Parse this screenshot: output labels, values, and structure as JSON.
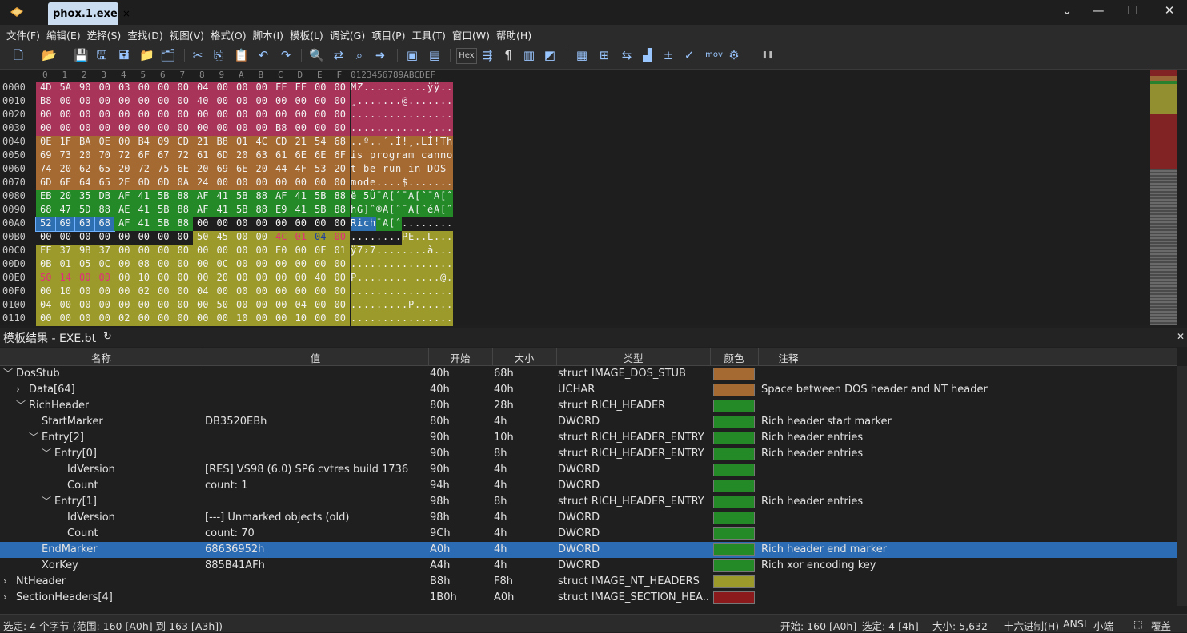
{
  "titlebar": {
    "tab_label": "phox.1.exe",
    "tab_close": "×",
    "btn_dropdown": "⌄",
    "btn_minimize": "—",
    "btn_maximize": "☐",
    "btn_close": "✕"
  },
  "menu": [
    "文件(F)",
    "编辑(E)",
    "选择(S)",
    "查找(D)",
    "视图(V)",
    "格式(O)",
    "脚本(I)",
    "模板(L)",
    "调试(G)",
    "项目(P)",
    "工具(T)",
    "窗口(W)",
    "帮助(H)"
  ],
  "toolbar_icons": [
    "new-file-icon",
    "open-icon",
    "save-icon",
    "save-as-icon",
    "save-all-icon",
    "open-folder-icon",
    "open-project-icon",
    "cut-icon",
    "copy-icon",
    "paste-icon",
    "undo-icon",
    "redo-icon",
    "find-icon",
    "replace-icon",
    "find-in-files-icon",
    "goto-icon",
    "run-script-icon",
    "run-template-icon",
    "hex-mode-icon",
    "columns-icon",
    "paragraph-icon",
    "bookmarks-icon",
    "highlight-icon",
    "calculator-icon",
    "checksum-icon",
    "compare-icon",
    "histogram-icon",
    "base-converter-icon",
    "inspector-icon",
    "disassembler-icon",
    "process-icon",
    "pause-icon"
  ],
  "toolbar_text": {
    "hex": "Hex",
    "mov": "mov",
    "pilcrow": "¶"
  },
  "hex": {
    "col_headers": [
      "0",
      "1",
      "2",
      "3",
      "4",
      "5",
      "6",
      "7",
      "8",
      "9",
      "A",
      "B",
      "C",
      "D",
      "E",
      "F"
    ],
    "ascii_header": "0123456789ABCDEF",
    "rows": [
      {
        "off": "0000",
        "bytes": [
          "4D",
          "5A",
          "90",
          "00",
          "03",
          "00",
          "00",
          "00",
          "04",
          "00",
          "00",
          "00",
          "FF",
          "FF",
          "00",
          "00"
        ],
        "ascii": "MZ..........ÿÿ.."
      },
      {
        "off": "0010",
        "bytes": [
          "B8",
          "00",
          "00",
          "00",
          "00",
          "00",
          "00",
          "00",
          "40",
          "00",
          "00",
          "00",
          "00",
          "00",
          "00",
          "00"
        ],
        "ascii": "¸.......@......."
      },
      {
        "off": "0020",
        "bytes": [
          "00",
          "00",
          "00",
          "00",
          "00",
          "00",
          "00",
          "00",
          "00",
          "00",
          "00",
          "00",
          "00",
          "00",
          "00",
          "00"
        ],
        "ascii": "................"
      },
      {
        "off": "0030",
        "bytes": [
          "00",
          "00",
          "00",
          "00",
          "00",
          "00",
          "00",
          "00",
          "00",
          "00",
          "00",
          "00",
          "B8",
          "00",
          "00",
          "00"
        ],
        "ascii": "............¸..."
      },
      {
        "off": "0040",
        "bytes": [
          "0E",
          "1F",
          "BA",
          "0E",
          "00",
          "B4",
          "09",
          "CD",
          "21",
          "B8",
          "01",
          "4C",
          "CD",
          "21",
          "54",
          "68"
        ],
        "ascii": "..º..´.Í!¸.LÍ!Th"
      },
      {
        "off": "0050",
        "bytes": [
          "69",
          "73",
          "20",
          "70",
          "72",
          "6F",
          "67",
          "72",
          "61",
          "6D",
          "20",
          "63",
          "61",
          "6E",
          "6E",
          "6F"
        ],
        "ascii": "is program canno"
      },
      {
        "off": "0060",
        "bytes": [
          "74",
          "20",
          "62",
          "65",
          "20",
          "72",
          "75",
          "6E",
          "20",
          "69",
          "6E",
          "20",
          "44",
          "4F",
          "53",
          "20"
        ],
        "ascii": "t be run in DOS "
      },
      {
        "off": "0070",
        "bytes": [
          "6D",
          "6F",
          "64",
          "65",
          "2E",
          "0D",
          "0D",
          "0A",
          "24",
          "00",
          "00",
          "00",
          "00",
          "00",
          "00",
          "00"
        ],
        "ascii": "mode....$......."
      },
      {
        "off": "0080",
        "bytes": [
          "EB",
          "20",
          "35",
          "DB",
          "AF",
          "41",
          "5B",
          "88",
          "AF",
          "41",
          "5B",
          "88",
          "AF",
          "41",
          "5B",
          "88"
        ],
        "ascii": "ë 5Û¯A[ˆ¯A[ˆ¯A[ˆ"
      },
      {
        "off": "0090",
        "bytes": [
          "68",
          "47",
          "5D",
          "88",
          "AE",
          "41",
          "5B",
          "88",
          "AF",
          "41",
          "5B",
          "88",
          "E9",
          "41",
          "5B",
          "88"
        ],
        "ascii": "hG]ˆ®A[ˆ¯A[ˆéA[ˆ"
      },
      {
        "off": "00A0",
        "bytes": [
          "52",
          "69",
          "63",
          "68",
          "AF",
          "41",
          "5B",
          "88",
          "00",
          "00",
          "00",
          "00",
          "00",
          "00",
          "00",
          "00"
        ],
        "ascii": "Rich¯A[ˆ........"
      },
      {
        "off": "00B0",
        "bytes": [
          "00",
          "00",
          "00",
          "00",
          "00",
          "00",
          "00",
          "00",
          "50",
          "45",
          "00",
          "00",
          "4C",
          "01",
          "04",
          "00"
        ],
        "ascii": "........PE..L..."
      },
      {
        "off": "00C0",
        "bytes": [
          "FF",
          "37",
          "9B",
          "37",
          "00",
          "00",
          "00",
          "00",
          "00",
          "00",
          "00",
          "00",
          "E0",
          "00",
          "0F",
          "01"
        ],
        "ascii": "ÿ7›7........à..."
      },
      {
        "off": "00D0",
        "bytes": [
          "0B",
          "01",
          "05",
          "0C",
          "00",
          "08",
          "00",
          "00",
          "00",
          "0C",
          "00",
          "00",
          "00",
          "00",
          "00",
          "00"
        ],
        "ascii": "................"
      },
      {
        "off": "00E0",
        "bytes": [
          "50",
          "14",
          "00",
          "00",
          "00",
          "10",
          "00",
          "00",
          "00",
          "20",
          "00",
          "00",
          "00",
          "00",
          "40",
          "00"
        ],
        "ascii": "P........ ....@."
      },
      {
        "off": "00F0",
        "bytes": [
          "00",
          "10",
          "00",
          "00",
          "00",
          "02",
          "00",
          "00",
          "04",
          "00",
          "00",
          "00",
          "00",
          "00",
          "00",
          "00"
        ],
        "ascii": "................"
      },
      {
        "off": "0100",
        "bytes": [
          "04",
          "00",
          "00",
          "00",
          "00",
          "00",
          "00",
          "00",
          "00",
          "50",
          "00",
          "00",
          "00",
          "04",
          "00",
          "00"
        ],
        "ascii": ".........P......"
      },
      {
        "off": "0110",
        "bytes": [
          "00",
          "00",
          "00",
          "00",
          "02",
          "00",
          "00",
          "00",
          "00",
          "00",
          "10",
          "00",
          "00",
          "10",
          "00",
          "00"
        ],
        "ascii": "................"
      }
    ]
  },
  "template_panel": {
    "title": "模板结果 - EXE.bt",
    "refresh_icon": "↻",
    "close_icon": "✕",
    "columns": [
      "名称",
      "值",
      "开始",
      "大小",
      "类型",
      "颜色",
      "注释"
    ],
    "rows": [
      {
        "toggle": "﹀",
        "indent": 0,
        "name": "DosStub",
        "value": "",
        "start": "40h",
        "size": "68h",
        "type": "struct IMAGE_DOS_STUB",
        "color": "#a46a32",
        "comment": "",
        "selected": false
      },
      {
        "toggle": "›",
        "indent": 1,
        "name": "Data[64]",
        "value": "",
        "start": "40h",
        "size": "40h",
        "type": "UCHAR",
        "color": "#a46a32",
        "comment": "Space between DOS header and NT header",
        "selected": false
      },
      {
        "toggle": "﹀",
        "indent": 1,
        "name": "RichHeader",
        "value": "",
        "start": "80h",
        "size": "28h",
        "type": "struct RICH_HEADER",
        "color": "#238a27",
        "comment": "",
        "selected": false
      },
      {
        "toggle": "",
        "indent": 2,
        "name": "StartMarker",
        "value": "DB3520EBh",
        "start": "80h",
        "size": "4h",
        "type": "DWORD",
        "color": "#238a27",
        "comment": "Rich header start marker",
        "selected": false
      },
      {
        "toggle": "﹀",
        "indent": 2,
        "name": "Entry[2]",
        "value": "",
        "start": "90h",
        "size": "10h",
        "type": "struct RICH_HEADER_ENTRY",
        "color": "#238a27",
        "comment": "Rich header entries",
        "selected": false
      },
      {
        "toggle": "﹀",
        "indent": 3,
        "name": "Entry[0]",
        "value": "",
        "start": "90h",
        "size": "8h",
        "type": "struct RICH_HEADER_ENTRY",
        "color": "#238a27",
        "comment": "Rich header entries",
        "selected": false
      },
      {
        "toggle": "",
        "indent": 4,
        "name": "IdVersion",
        "value": "[RES] VS98 (6.0) SP6 cvtres build 1736",
        "start": "90h",
        "size": "4h",
        "type": "DWORD",
        "color": "#238a27",
        "comment": "",
        "selected": false
      },
      {
        "toggle": "",
        "indent": 4,
        "name": "Count",
        "value": "count: 1",
        "start": "94h",
        "size": "4h",
        "type": "DWORD",
        "color": "#238a27",
        "comment": "",
        "selected": false
      },
      {
        "toggle": "﹀",
        "indent": 3,
        "name": "Entry[1]",
        "value": "",
        "start": "98h",
        "size": "8h",
        "type": "struct RICH_HEADER_ENTRY",
        "color": "#238a27",
        "comment": "Rich header entries",
        "selected": false
      },
      {
        "toggle": "",
        "indent": 4,
        "name": "IdVersion",
        "value": "[---] Unmarked objects (old)",
        "start": "98h",
        "size": "4h",
        "type": "DWORD",
        "color": "#238a27",
        "comment": "",
        "selected": false
      },
      {
        "toggle": "",
        "indent": 4,
        "name": "Count",
        "value": "count: 70",
        "start": "9Ch",
        "size": "4h",
        "type": "DWORD",
        "color": "#238a27",
        "comment": "",
        "selected": false
      },
      {
        "toggle": "",
        "indent": 2,
        "name": "EndMarker",
        "value": "68636952h",
        "start": "A0h",
        "size": "4h",
        "type": "DWORD",
        "color": "#238a27",
        "comment": "Rich header end marker",
        "selected": true
      },
      {
        "toggle": "",
        "indent": 2,
        "name": "XorKey",
        "value": "885B41AFh",
        "start": "A4h",
        "size": "4h",
        "type": "DWORD",
        "color": "#238a27",
        "comment": "Rich xor encoding key",
        "selected": false
      },
      {
        "toggle": "›",
        "indent": 0,
        "name": "NtHeader",
        "value": "",
        "start": "B8h",
        "size": "F8h",
        "type": "struct IMAGE_NT_HEADERS",
        "color": "#9c9a2a",
        "comment": "",
        "selected": false
      },
      {
        "toggle": "›",
        "indent": 0,
        "name": "SectionHeaders[4]",
        "value": "",
        "start": "1B0h",
        "size": "A0h",
        "type": "struct IMAGE_SECTION_HEA...",
        "color": "#8a1a1c",
        "comment": "",
        "selected": false
      }
    ]
  },
  "status": {
    "selection": "选定: 4 个字节 (范围: 160 [A0h] 到 163 [A3h])",
    "start": "开始: 160 [A0h]",
    "sel": "选定: 4 [4h]",
    "size": "大小: 5,632",
    "mode": "十六进制(H)",
    "encoding": "ANSI",
    "endian": "小端",
    "overwrite": "覆盖",
    "lock_icon": "⬚"
  },
  "colors": {
    "dos_header": "#a8345a",
    "dos_stub": "#a46a32",
    "rich": "#238a27",
    "rich_marker": "#2d6fb1",
    "nt_header": "#9c9a2a",
    "section": "#8a1a1c",
    "selection": "#2c6cb4"
  }
}
